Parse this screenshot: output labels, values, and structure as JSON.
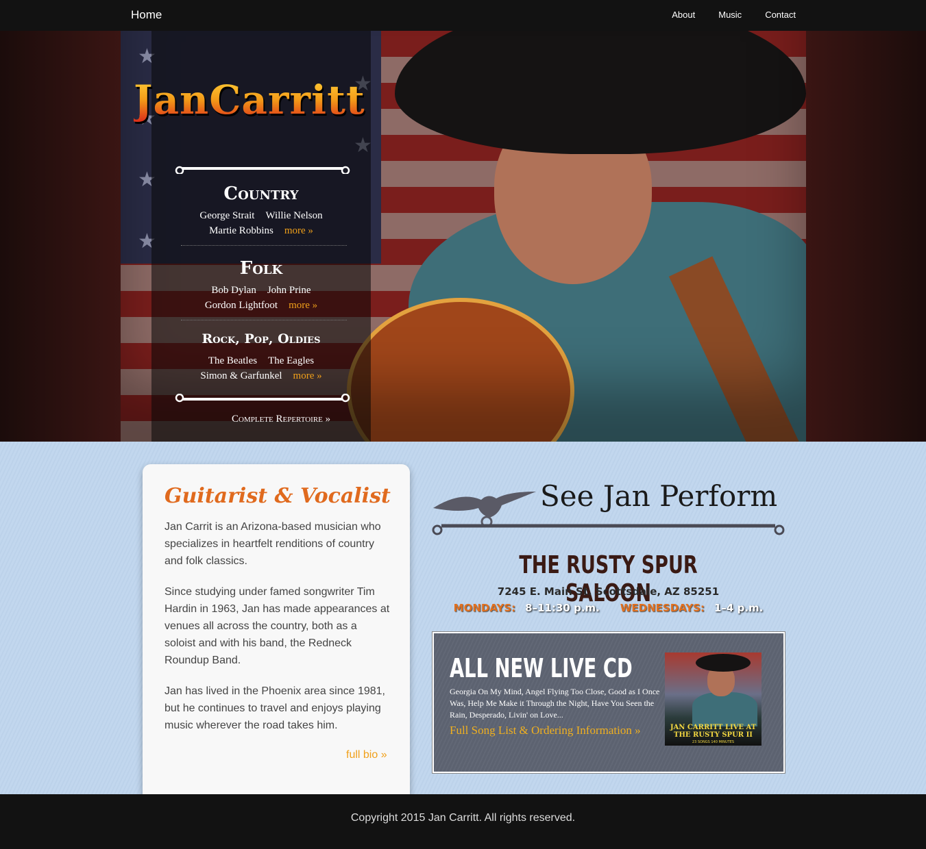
{
  "nav": {
    "home": "Home",
    "links": [
      "About",
      "Music",
      "Contact"
    ]
  },
  "hero": {
    "logo": "JanCarritt",
    "genres": [
      {
        "title": "Country",
        "artists_row1": [
          "George Strait",
          "Willie Nelson"
        ],
        "artists_row2": "Martie Robbins",
        "more": "more »"
      },
      {
        "title": "Folk",
        "artists_row1": [
          "Bob Dylan",
          "John Prine"
        ],
        "artists_row2": "Gordon Lightfoot",
        "more": "more »"
      },
      {
        "title": "Rock, Pop, Oldies",
        "artists_row1": [
          "The Beatles",
          "The Eagles"
        ],
        "artists_row2": "Simon & Garfunkel",
        "more": "more »"
      }
    ],
    "repertoire": "Complete Repertoire »"
  },
  "bio": {
    "title": "Guitarist & Vocalist",
    "p1": "Jan Carrit is an Arizona-based musician who specializes in heartfelt renditions of country and folk classics.",
    "p2": "Since studying under famed songwriter Tim Hardin in 1963, Jan has made appearances at venues all across the country, both as a soloist and with his band, the Redneck Roundup Band.",
    "p3": "Jan has lived in the Phoenix area since 1981, but he continues to travel and enjoys playing music wherever the road takes him.",
    "full_bio": "full bio »"
  },
  "perform": {
    "title": "See Jan Perform",
    "venue": "THE RUSTY SPUR SALOON",
    "address": "7245 E. Main St. Scottsdale, AZ 85251",
    "day1": "MONDAYS:",
    "time1": "8–11:30 p.m.",
    "day2": "WEDNESDAYS:",
    "time2": "1–4 p.m."
  },
  "cd": {
    "title": "ALL NEW LIVE CD",
    "songs": "Georgia On My Mind, Angel Flying Too Close, Good as I Once Was, Help Me Make it Through the Night, Have You Seen the Rain, Desperado, Livin' on Love...",
    "link": "Full Song List & Ordering Information »",
    "cover_title": "JAN CARRITT LIVE AT THE RUSTY SPUR II",
    "cover_sub": "23 SONGS 140 MINUTES"
  },
  "footer": {
    "copyright": "Copyright 2015 Jan Carritt. All rights reserved."
  },
  "colors": {
    "accent_orange": "#f0a01a",
    "title_orange": "#e06a1e",
    "nav_bg": "#121212",
    "page_bg": "#c5d9ef"
  }
}
